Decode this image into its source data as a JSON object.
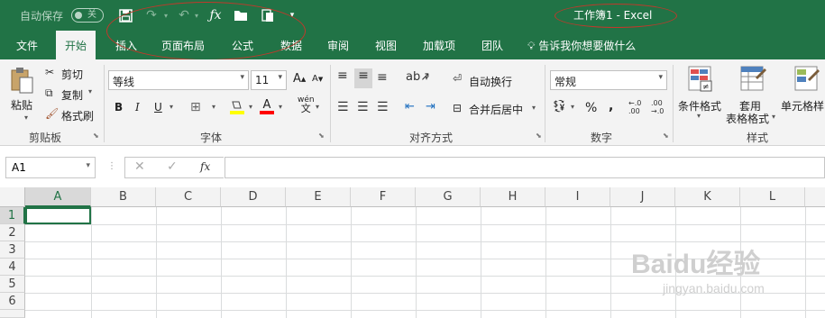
{
  "titlebar": {
    "autosave_label": "自动保存",
    "autosave_state": "关",
    "doc_title": "工作簿1  -  Excel"
  },
  "tabs": [
    "文件",
    "开始",
    "插入",
    "页面布局",
    "公式",
    "数据",
    "审阅",
    "视图",
    "加载项",
    "团队"
  ],
  "tell_me": "告诉我你想要做什么",
  "clipboard": {
    "paste": "粘贴",
    "cut": "剪切",
    "copy": "复制",
    "format_painter": "格式刷",
    "group": "剪贴板"
  },
  "font": {
    "name": "等线",
    "size": "11",
    "bold": "B",
    "italic": "I",
    "underline": "U",
    "group": "字体",
    "wen": "wén",
    "wen_char": "文"
  },
  "alignment": {
    "wrap": "自动换行",
    "merge": "合并后居中",
    "group": "对齐方式"
  },
  "number": {
    "format": "常规",
    "percent": "%",
    "group": "数字"
  },
  "styles": {
    "conditional": "条件格式",
    "table_line1": "套用",
    "table_line2": "表格格式",
    "cell_styles": "单元格样",
    "group": "样式"
  },
  "formula_bar": {
    "name_box": "A1",
    "fx": "fx"
  },
  "columns": [
    "A",
    "B",
    "C",
    "D",
    "E",
    "F",
    "G",
    "H",
    "I",
    "J",
    "K",
    "L"
  ],
  "rows": [
    "1",
    "2",
    "3",
    "4",
    "5",
    "6"
  ],
  "watermark": {
    "brand": "Baidu经验",
    "url": "jingyan.baidu.com"
  },
  "colors": {
    "excel_green": "#217346",
    "annotation_red": "#c0392b"
  }
}
